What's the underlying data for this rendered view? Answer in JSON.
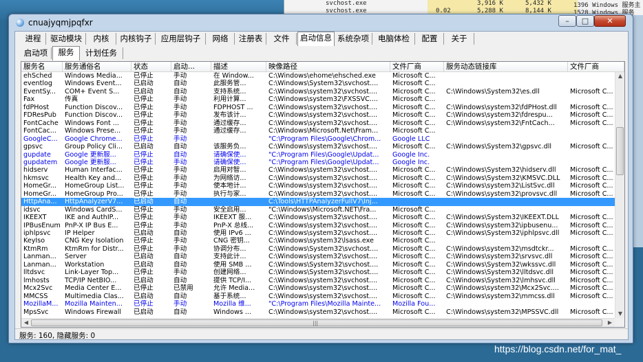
{
  "background_window": {
    "rows": [
      {
        "name": "svchost.exe",
        "mem1": "3,916 K",
        "mem2": "5,432 K",
        "pid_desc": "1396 Windows 服务主"
      },
      {
        "name": "svchost.exe",
        "cpu": "0.02",
        "mem1": "5,288 K",
        "mem2": "8,144 K",
        "pid_desc": "1528 Windows 服务"
      }
    ]
  },
  "window": {
    "title": "cnuajyqmjpqfxr",
    "min_glyph": "–",
    "max_glyph": "□",
    "close_glyph": "✕"
  },
  "main_tabs": [
    "进程",
    "驱动模块",
    "内核",
    "内核钩子",
    "应用层钩子",
    "网络",
    "注册表",
    "文件",
    "启动信息",
    "系统杂项",
    "电脑体检",
    "配置",
    "关于"
  ],
  "active_main_tab": "启动信息",
  "sub_tabs": [
    "启动项",
    "服务",
    "计划任务"
  ],
  "active_sub_tab": "服务",
  "columns": [
    "服务名",
    "服务通俗名",
    "状态",
    "启动...",
    "描述",
    "映像路径",
    "文件厂商",
    "服务动态链接库",
    "文件厂商"
  ],
  "rows": [
    [
      "ehSched",
      "Windows Media...",
      "已停止",
      "手动",
      "在 Window...",
      "C:\\Windows\\ehome\\ehsched.exe",
      "Microsoft C...",
      "",
      ""
    ],
    [
      "eventlog",
      "Windows Event...",
      "已启动",
      "自动",
      "此服务管...",
      "C:\\Windows\\System32\\svchost....",
      "Microsoft C...",
      "",
      ""
    ],
    [
      "EventSy...",
      "COM+ Event S...",
      "已启动",
      "自动",
      "支持系统...",
      "C:\\Windows\\system32\\svchost....",
      "Microsoft C...",
      "C:\\Windows\\System32\\es.dll",
      "Microsoft C..."
    ],
    [
      "Fax",
      "传真",
      "已停止",
      "手动",
      "利用计算...",
      "C:\\Windows\\system32\\FXSSVC....",
      "Microsoft C...",
      "",
      ""
    ],
    [
      "fdPHost",
      "Function Discov...",
      "已停止",
      "手动",
      "FDPHOST ...",
      "C:\\Windows\\system32\\svchost....",
      "Microsoft C...",
      "C:\\Windows\\system32\\fdPHost.dll",
      "Microsoft C..."
    ],
    [
      "FDResPub",
      "Function Discov...",
      "已停止",
      "手动",
      "发布该计...",
      "C:\\Windows\\system32\\svchost....",
      "Microsoft C...",
      "C:\\Windows\\system32\\fdrespu...",
      "Microsoft C..."
    ],
    [
      "FontCache",
      "Windows Font ...",
      "已停止",
      "手动",
      "通过缓存...",
      "C:\\Windows\\system32\\svchost....",
      "Microsoft C...",
      "C:\\Windows\\system32\\FntCach...",
      "Microsoft C..."
    ],
    [
      "FontCac...",
      "Windows Prese...",
      "已停止",
      "手动",
      "通过缓存...",
      "C:\\Windows\\Microsoft.Net\\Fram...",
      "Microsoft C...",
      "",
      ""
    ],
    [
      "GoogleC...",
      "Google Chrome...",
      "已停止",
      "手动",
      "",
      "\"C:\\Program Files\\Google\\Chrom...",
      "Google LLC",
      "",
      ""
    ],
    [
      "gpsvc",
      "Group Policy Cli...",
      "已启动",
      "自动",
      "该服务负...",
      "C:\\Windows\\system32\\svchost....",
      "Microsoft C...",
      "C:\\Windows\\System32\\gpsvc.dll",
      "Microsoft C..."
    ],
    [
      "gupdate",
      "Google 更新服...",
      "已停止",
      "自动",
      "请确保使...",
      "\"C:\\Program Files\\Google\\Updat...",
      "Google Inc.",
      "",
      ""
    ],
    [
      "gupdatem",
      "Google 更新服...",
      "已停止",
      "手动",
      "请确保使...",
      "\"C:\\Program Files\\Google\\Updat...",
      "Google Inc.",
      "",
      ""
    ],
    [
      "hidserv",
      "Human Interfac...",
      "已停止",
      "手动",
      "启用对智...",
      "C:\\Windows\\system32\\svchost....",
      "Microsoft C...",
      "C:\\Windows\\System32\\hidserv.dll",
      "Microsoft C..."
    ],
    [
      "hkmsvc",
      "Health Key and...",
      "已停止",
      "手动",
      "为网络访...",
      "C:\\Windows\\system32\\svchost....",
      "Microsoft C...",
      "C:\\Windows\\System32\\KMSVC.DLL",
      "Microsoft C..."
    ],
    [
      "HomeGr...",
      "HomeGroup List...",
      "已停止",
      "手动",
      "使本地计...",
      "C:\\Windows\\system32\\svchost....",
      "Microsoft C...",
      "C:\\Windows\\system32\\ListSvc.dll",
      "Microsoft C..."
    ],
    [
      "HomeGr...",
      "HomeGroup Pro...",
      "已停止",
      "手动",
      "执行与家...",
      "C:\\Windows\\system32\\svchost....",
      "Microsoft C...",
      "C:\\Windows\\system32\\provsvc.dll",
      "Microsoft C..."
    ],
    [
      "HttpAna...",
      "HttpAnalyzerV7...",
      "已启动",
      "自动",
      "",
      "C:\\Tools\\HTTPAnalyzerFullV7\\Inj...",
      "",
      "",
      ""
    ],
    [
      "idsvc",
      "Windows CardS...",
      "已停止",
      "手动",
      "安全启用...",
      "\"C:\\Windows\\Microsoft.NET\\Fra...",
      "Microsoft C...",
      "",
      ""
    ],
    [
      "IKEEXT",
      "IKE and AuthIP...",
      "已停止",
      "手动",
      "IKEEXT 服...",
      "C:\\Windows\\system32\\svchost....",
      "Microsoft C...",
      "C:\\Windows\\System32\\IKEEXT.DLL",
      "Microsoft C..."
    ],
    [
      "IPBusEnum",
      "PnP-X IP Bus E...",
      "已停止",
      "手动",
      "PnP-X 总线...",
      "C:\\Windows\\system32\\svchost....",
      "Microsoft C...",
      "C:\\Windows\\system32\\ipbusenu...",
      "Microsoft C..."
    ],
    [
      "iphlpsvc",
      "IP Helper",
      "已启动",
      "自动",
      "使用 IPv6 ...",
      "C:\\Windows\\system32\\svchost....",
      "Microsoft C...",
      "C:\\Windows\\System32\\iphlpsvc.dll",
      "Microsoft C..."
    ],
    [
      "KeyIso",
      "CNG Key Isolation",
      "已停止",
      "手动",
      "CNG 密钥...",
      "C:\\Windows\\system32\\lsass.exe",
      "Microsoft C...",
      "",
      ""
    ],
    [
      "KtmRm",
      "KtmRm for Distr...",
      "已停止",
      "手动",
      "协调分布...",
      "C:\\Windows\\System32\\svchost....",
      "Microsoft C...",
      "C:\\Windows\\system32\\msdtckr...",
      "Microsoft C..."
    ],
    [
      "Lanman...",
      "Server",
      "已启动",
      "自动",
      "支持此计...",
      "C:\\Windows\\system32\\svchost....",
      "Microsoft C...",
      "C:\\Windows\\system32\\srvsvc.dll",
      "Microsoft C..."
    ],
    [
      "Lanman...",
      "Workstation",
      "已启动",
      "自动",
      "使用 SMB ...",
      "C:\\Windows\\System32\\svchost....",
      "Microsoft C...",
      "C:\\Windows\\System32\\wkssvc.dll",
      "Microsoft C..."
    ],
    [
      "lltdsvc",
      "Link-Layer Top...",
      "已停止",
      "手动",
      "创建网络...",
      "C:\\Windows\\System32\\svchost....",
      "Microsoft C...",
      "C:\\Windows\\System32\\lltdsvc.dll",
      "Microsoft C..."
    ],
    [
      "lmhosts",
      "TCP/IP NetBIO...",
      "已启动",
      "自动",
      "提供 TCP/I...",
      "C:\\Windows\\system32\\svchost....",
      "Microsoft C...",
      "C:\\Windows\\System32\\lmhsvc.dll",
      "Microsoft C..."
    ],
    [
      "Mcx2Svc",
      "Media Center E...",
      "已停止",
      "已禁用",
      "允许 Media...",
      "C:\\Windows\\system32\\svchost....",
      "Microsoft C...",
      "C:\\Windows\\system32\\Mcx2Svc....",
      "Microsoft C..."
    ],
    [
      "MMCSS",
      "Multimedia Clas...",
      "已启动",
      "自动",
      "基于系统...",
      "C:\\Windows\\system32\\svchost....",
      "Microsoft C...",
      "C:\\Windows\\system32\\mmcss.dll",
      "Microsoft C..."
    ],
    [
      "MozillaM...",
      "Mozilla Mainten...",
      "已停止",
      "手动",
      "Mozilla 维...",
      "\"C:\\Program Files\\Mozilla Mainte...",
      "Mozilla Fou...",
      "",
      ""
    ],
    [
      "MpsSvc",
      "Windows Firewall",
      "已启动",
      "自动",
      "Windows ...",
      "C:\\Windows\\system32\\svchost....",
      "Microsoft C...",
      "C:\\Windows\\system32\\MPSSVC.dll",
      "Microsoft C..."
    ]
  ],
  "status": "服务: 160, 隐藏服务: 0",
  "watermark": "https://blog.csdn.net/for_mat_",
  "colors": {
    "non_microsoft_row": "#0000ee",
    "selection": "#3399ff"
  }
}
